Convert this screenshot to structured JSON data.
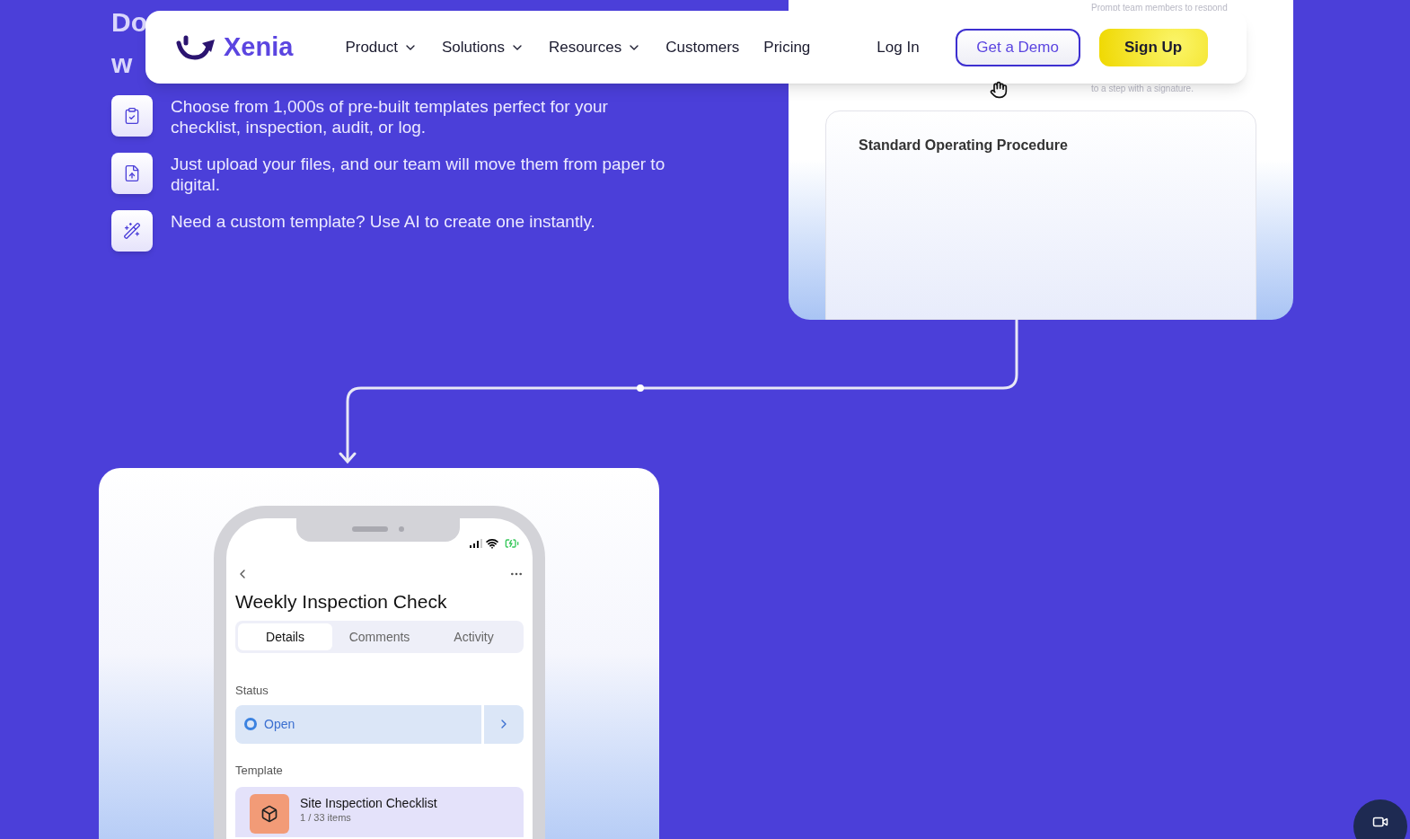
{
  "heading_fragments": [
    "Do",
    "w"
  ],
  "nav": {
    "logo": "Xenia",
    "items": [
      {
        "label": "Product",
        "dropdown": true
      },
      {
        "label": "Solutions",
        "dropdown": true
      },
      {
        "label": "Resources",
        "dropdown": true
      },
      {
        "label": "Customers",
        "dropdown": false
      },
      {
        "label": "Pricing",
        "dropdown": false
      }
    ],
    "login": "Log In",
    "demo": "Get a Demo",
    "signup": "Sign Up"
  },
  "features": [
    {
      "kind": "clipboard",
      "text": "Choose from 1,000s of pre-built templates perfect for your checklist, inspection, audit, or log."
    },
    {
      "kind": "upload",
      "text": "Just upload your files, and our team will move them from paper to digital."
    },
    {
      "kind": "wand",
      "text": "Need a custom template? Use AI to create one instantly."
    }
  ],
  "preview_card": {
    "hint_lines": [
      "Prompt team members to respond",
      "to a step with a signature."
    ],
    "document_title": "Standard Operating Procedure"
  },
  "phone": {
    "title": "Weekly Inspection Check",
    "tabs": [
      {
        "label": "Details",
        "selected": true
      },
      {
        "label": "Comments",
        "selected": false
      },
      {
        "label": "Activity",
        "selected": false
      }
    ],
    "status_label": "Status",
    "status": "Open",
    "template_label": "Template",
    "template_name": "Site Inspection Checklist",
    "template_count": "1 / 33 items"
  }
}
